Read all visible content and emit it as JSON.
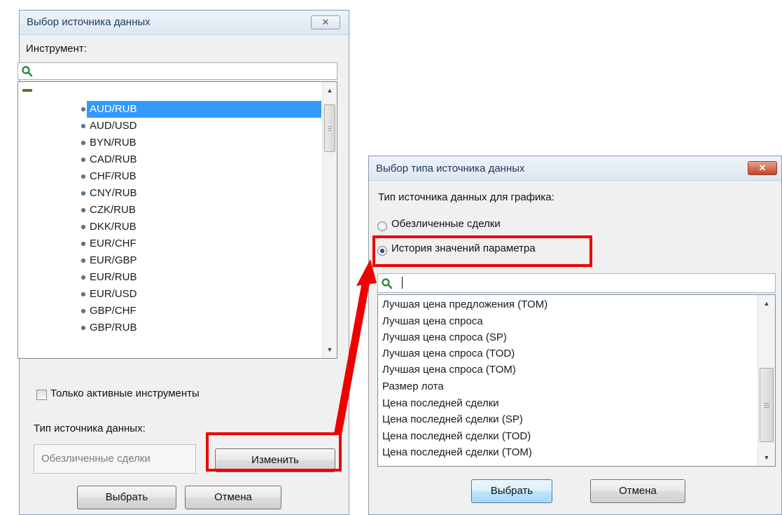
{
  "left_dialog": {
    "title": "Выбор источника данных",
    "close_glyph": "✕",
    "instrument_label": "Инструмент:",
    "tree_collapse_icon": "minus-icon",
    "instruments": [
      "AUD/RUB",
      "AUD/USD",
      "BYN/RUB",
      "CAD/RUB",
      "CHF/RUB",
      "CNY/RUB",
      "CZK/RUB",
      "DKK/RUB",
      "EUR/CHF",
      "EUR/GBP",
      "EUR/RUB",
      "EUR/USD",
      "GBP/CHF",
      "GBP/RUB"
    ],
    "selected_instrument": "AUD/RUB",
    "only_active_label": "Только активные инструменты",
    "only_active_checked": false,
    "source_type_label": "Тип источника данных:",
    "source_type_value": "Обезличенные сделки",
    "change_button": "Изменить",
    "select_button": "Выбрать",
    "cancel_button": "Отмена"
  },
  "right_dialog": {
    "title": "Выбор типа источника данных",
    "close_glyph": "✕",
    "chart_source_label": "Тип источника данных для графика:",
    "radio_options": [
      {
        "label": "Обезличенные сделки",
        "selected": false
      },
      {
        "label": "История значений параметра",
        "selected": true
      }
    ],
    "search_value": "",
    "parameters": [
      "Лучшая цена предложения (TOM)",
      "Лучшая цена спроса",
      "Лучшая цена спроса (SP)",
      "Лучшая цена спроса (TOD)",
      "Лучшая цена спроса (TOM)",
      "Размер лота",
      "Цена последней сделки",
      "Цена последней сделки (SP)",
      "Цена последней сделки (TOD)",
      "Цена последней сделки (TOM)"
    ],
    "select_button": "Выбрать",
    "cancel_button": "Отмена"
  },
  "scroll_arrows": {
    "up": "▲",
    "down": "▼"
  },
  "annotations": {
    "highlight_color": "#ee0000"
  },
  "colors": {
    "selection": "#3399ff",
    "search_icon": "#2e8b3a",
    "title_text": "#1e395b"
  }
}
